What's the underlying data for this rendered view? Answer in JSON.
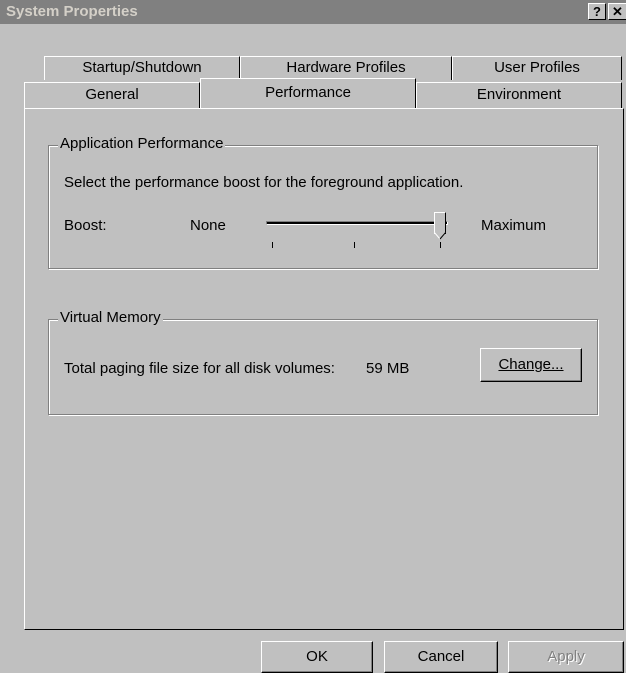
{
  "window": {
    "title": "System Properties",
    "help_button": "?",
    "close_button": "✕"
  },
  "tabs": {
    "back_row": [
      "Startup/Shutdown",
      "Hardware Profiles",
      "User Profiles"
    ],
    "front_row": [
      "General",
      "Performance",
      "Environment"
    ],
    "active": "Performance"
  },
  "app_performance": {
    "group_label": "Application Performance",
    "description": "Select the performance boost for the foreground application.",
    "boost_label": "Boost:",
    "min_label": "None",
    "max_label": "Maximum",
    "slider_level": "Maximum"
  },
  "virtual_memory": {
    "group_label": "Virtual Memory",
    "paging_label": "Total paging file size for all disk volumes:",
    "paging_value": "59 MB",
    "change_button": "Change..."
  },
  "dialog_buttons": {
    "ok": "OK",
    "cancel": "Cancel",
    "apply": "Apply"
  }
}
